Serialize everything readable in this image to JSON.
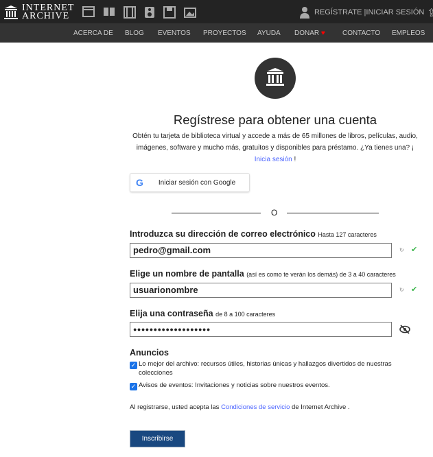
{
  "header": {
    "logo": "INTERNET ARCHIVE",
    "logo_line1": "INTERNET",
    "logo_line2": "ARCHIVE",
    "media_icons": [
      "web-icon",
      "texts-icon",
      "video-icon",
      "audio-icon",
      "software-icon",
      "images-icon"
    ],
    "signup": "REGÍSTRATE",
    "separator": "|",
    "login": "INICIAR SESIÓN"
  },
  "nav": [
    "ACERCA DE",
    "BLOG",
    "EVENTOS",
    "PROYECTOS",
    "AYUDA",
    "DONAR",
    "CONTACTO",
    "EMPLEOS"
  ],
  "form": {
    "title": "Regístrese para obtener una cuenta",
    "desc": "Obtén tu tarjeta de biblioteca virtual y accede a más de 65 millones de libros, películas, audio, imágenes, software y mucho más, gratuitos y disponibles para préstamo. ¿Ya tienes una? ¡ ",
    "login_link": "Inicia sesión",
    "desc_end": " !",
    "google": "Iniciar sesión con Google",
    "or": "O",
    "email_label": "Introduzca su dirección de correo electrónico",
    "email_hint": "Hasta 127 caracteres",
    "email_value": "pedro@gmail.com",
    "name_label": "Elige un nombre de pantalla",
    "name_hint": "(así es como te verán los demás) de 3 a 40 caracteres",
    "name_value": "usuarionombre",
    "pass_label": "Elija una contraseña",
    "pass_hint": "de 8 a 100 caracteres",
    "pass_value": "●●●●●●●●●●●●●●●●●●●",
    "ads_title": "Anuncios",
    "ad1": "Lo mejor del archivo: recursos útiles, historias únicas y hallazgos divertidos de nuestras colecciones",
    "ad1_checked": true,
    "ad2": "Avisos de eventos: Invitaciones y noticias sobre nuestros eventos.",
    "ad2_checked": true,
    "terms_pre": "Al registrarse, usted acepta las ",
    "terms_link": "Condiciones de servicio",
    "terms_post": " de Internet Archive .",
    "submit": "Inscribirse"
  },
  "colors": {
    "accent": "#194880",
    "link": "#4b64ff",
    "valid": "#3ab64a",
    "heart": "#f00"
  }
}
